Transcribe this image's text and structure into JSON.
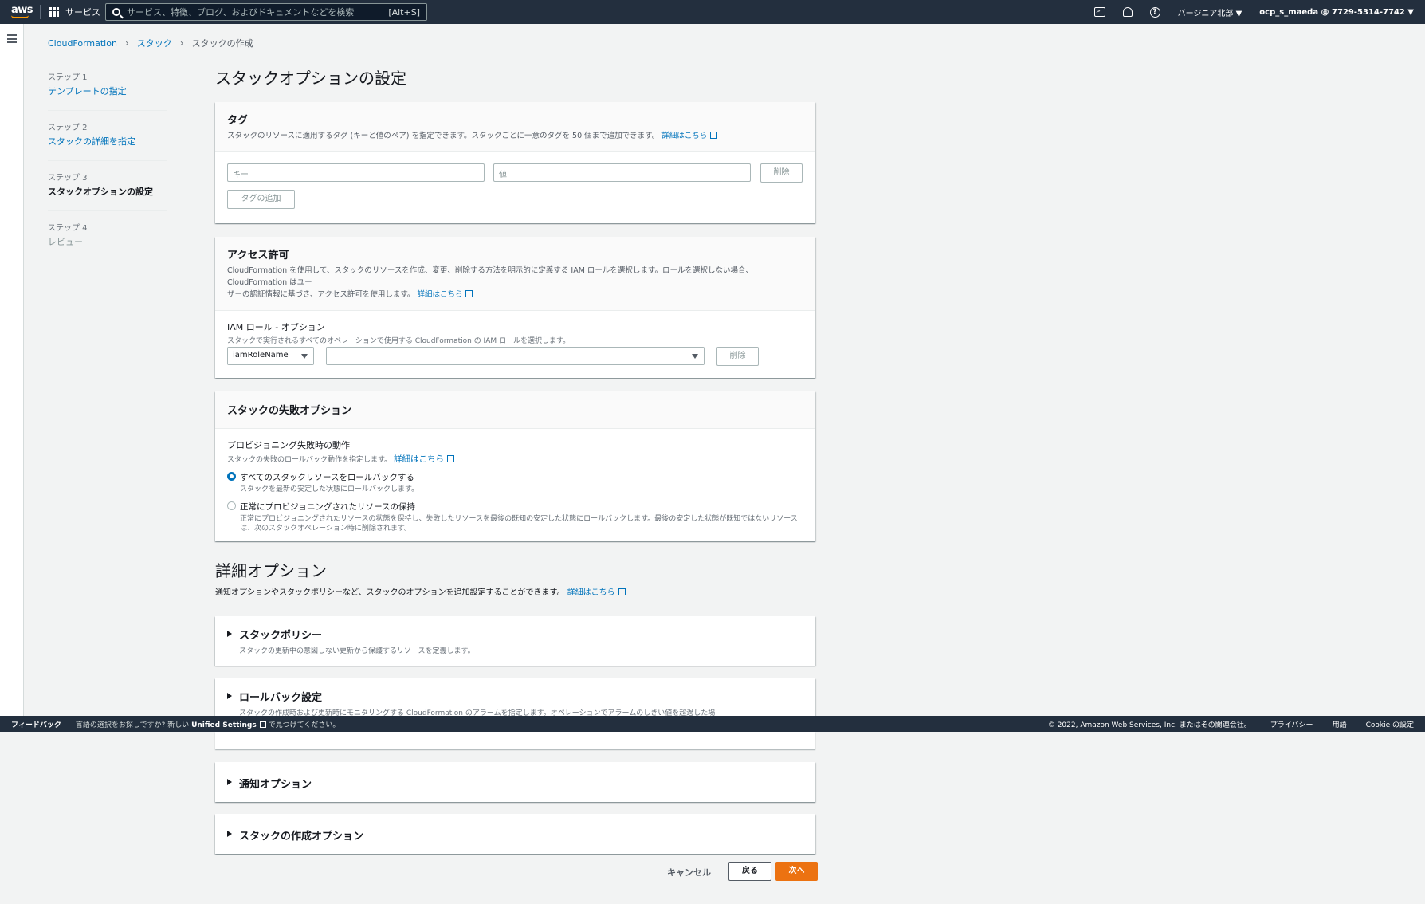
{
  "topnav": {
    "logo": "aws",
    "services_label": "サービス",
    "search_placeholder": "サービス、特徴、ブログ、およびドキュメントなどを検索",
    "search_shortcut": "[Alt+S]",
    "region": "バージニア北部 ▼",
    "account": "ocp_s_maeda @ 7729-5314-7742 ▼"
  },
  "breadcrumb": [
    "CloudFormation",
    "スタック",
    "スタックの作成"
  ],
  "steps": [
    {
      "num": "ステップ 1",
      "label": "テンプレートの指定"
    },
    {
      "num": "ステップ 2",
      "label": "スタックの詳細を指定"
    },
    {
      "num": "ステップ 3",
      "label": "スタックオプションの設定"
    },
    {
      "num": "ステップ 4",
      "label": "レビュー"
    }
  ],
  "page_title": "スタックオプションの設定",
  "tags": {
    "title": "タグ",
    "desc": "スタックのリソースに適用するタグ (キーと値のペア) を指定できます。スタックごとに一意のタグを 50 個まで追加できます。",
    "learn_more": "詳細はこちら",
    "key_placeholder": "キー",
    "value_placeholder": "値",
    "remove": "削除",
    "add": "タグの追加"
  },
  "permissions": {
    "title": "アクセス許可",
    "desc1": "CloudFormation を使用して、スタックのリソースを作成、変更、削除する方法を明示的に定義する IAM ロールを選択します。ロールを選択しない場合、CloudFormation はユー",
    "desc2": "ザーの認証情報に基づき、アクセス許可を使用します。",
    "learn_more": "詳細はこちら",
    "role_label": "IAM ロール - オプション",
    "role_desc": "スタックで実行されるすべてのオペレーションで使用する CloudFormation の IAM ロールを選択します。",
    "role_type": "iamRoleName",
    "role_value": "",
    "remove": "削除"
  },
  "failure": {
    "title": "スタックの失敗オプション",
    "field_label": "プロビジョニング失敗時の動作",
    "field_desc": "スタックの失敗のロールバック動作を指定します。",
    "learn_more": "詳細はこちら",
    "option1_label": "すべてのスタックリソースをロールバックする",
    "option1_desc": "スタックを最新の安定した状態にロールバックします。",
    "option2_label": "正常にプロビジョニングされたリソースの保持",
    "option2_desc1": "正常にプロビジョニングされたリソースの状態を保持し、失敗したリソースを最後の既知の安定した状態にロールバックします。最後の安定した状態が既知ではないリソース",
    "option2_desc2": "は、次のスタックオペレーション時に削除されます。"
  },
  "advanced": {
    "title": "詳細オプション",
    "desc": "通知オプションやスタックポリシーなど、スタックのオプションを追加設定することができます。",
    "learn_more": "詳細はこちら",
    "policy_title": "スタックポリシー",
    "policy_desc": "スタックの更新中の意図しない更新から保護するリソースを定義します。",
    "rollback_title": "ロールバック設定",
    "rollback_desc": "スタックの作成時および更新時にモニタリングする CloudFormation のアラームを指定します。オペレーションでアラームのしきい値を超過した場",
    "notify_title": "通知オプション",
    "create_title": "スタックの作成オプション"
  },
  "footer": {
    "feedback": "フィードバック",
    "msg_pre": "言語の選択をお探しですか? 新しい",
    "msg_link": "Unified Settings",
    "msg_post": "で見つけてください。",
    "copyright": "© 2022, Amazon Web Services, Inc. またはその関連会社。",
    "privacy": "プライバシー",
    "terms": "用語",
    "cookie": "Cookie の設定"
  },
  "actions": {
    "cancel": "キャンセル",
    "back": "戻る",
    "next": "次へ"
  }
}
